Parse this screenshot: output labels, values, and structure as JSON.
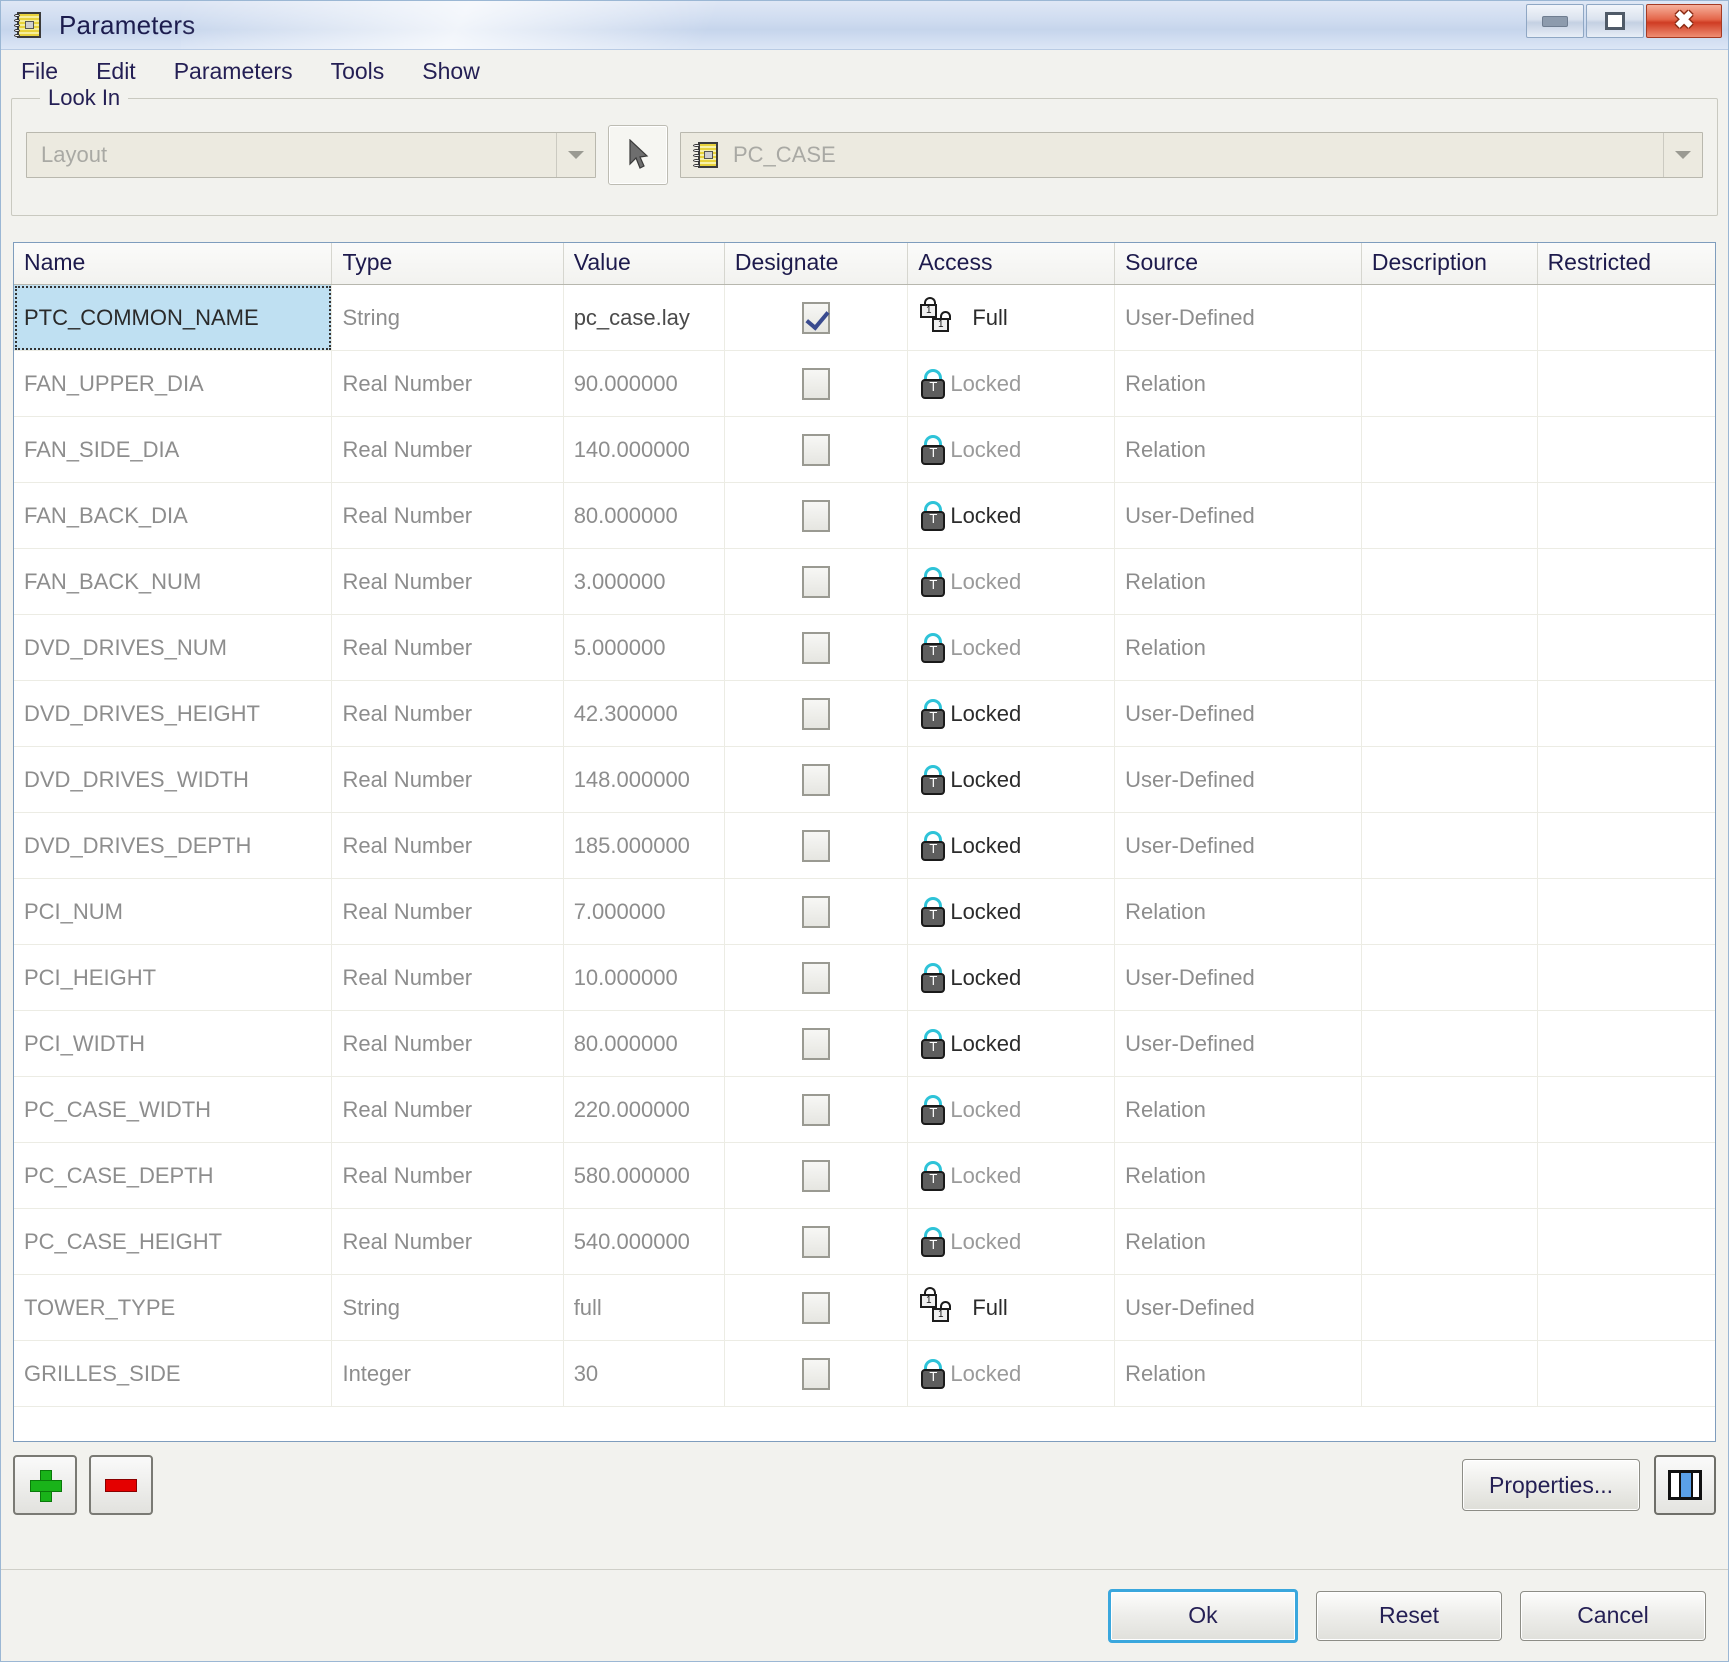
{
  "window": {
    "title": "Parameters",
    "icon": "notepad-icon",
    "controls": {
      "minimize": "minimize-icon",
      "maximize": "maximize-icon",
      "close": "close-icon"
    }
  },
  "menubar": {
    "items": [
      "File",
      "Edit",
      "Parameters",
      "Tools",
      "Show"
    ]
  },
  "look_in": {
    "legend": "Look In",
    "scope_select": {
      "value": "Layout",
      "placeholder": "Layout"
    },
    "pick_button": "select-arrow-icon",
    "object_select": {
      "value": "PC_CASE",
      "icon": "notepad-icon"
    }
  },
  "table": {
    "columns": [
      "Name",
      "Type",
      "Value",
      "Designate",
      "Access",
      "Source",
      "Description",
      "Restricted"
    ],
    "rows": [
      {
        "name": "PTC_COMMON_NAME",
        "type": "String",
        "value": "pc_case.lay",
        "designate": true,
        "access": "Full",
        "access_icon": "unlocked-pair-icon",
        "source": "User-Defined",
        "description": "",
        "restricted": "",
        "selected": true,
        "accent": true
      },
      {
        "name": "FAN_UPPER_DIA",
        "type": "Real Number",
        "value": "90.000000",
        "designate": false,
        "access": "Locked",
        "access_icon": "locked-icon",
        "source": "Relation",
        "description": "",
        "restricted": "",
        "selected": false,
        "accent": false
      },
      {
        "name": "FAN_SIDE_DIA",
        "type": "Real Number",
        "value": "140.000000",
        "designate": false,
        "access": "Locked",
        "access_icon": "locked-icon",
        "source": "Relation",
        "description": "",
        "restricted": "",
        "selected": false,
        "accent": false
      },
      {
        "name": "FAN_BACK_DIA",
        "type": "Real Number",
        "value": "80.000000",
        "designate": false,
        "access": "Locked",
        "access_icon": "locked-icon",
        "source": "User-Defined",
        "description": "",
        "restricted": "",
        "selected": false,
        "accent": true
      },
      {
        "name": "FAN_BACK_NUM",
        "type": "Real Number",
        "value": "3.000000",
        "designate": false,
        "access": "Locked",
        "access_icon": "locked-icon",
        "source": "Relation",
        "description": "",
        "restricted": "",
        "selected": false,
        "accent": false
      },
      {
        "name": "DVD_DRIVES_NUM",
        "type": "Real Number",
        "value": "5.000000",
        "designate": false,
        "access": "Locked",
        "access_icon": "locked-icon",
        "source": "Relation",
        "description": "",
        "restricted": "",
        "selected": false,
        "accent": false
      },
      {
        "name": "DVD_DRIVES_HEIGHT",
        "type": "Real Number",
        "value": "42.300000",
        "designate": false,
        "access": "Locked",
        "access_icon": "locked-icon",
        "source": "User-Defined",
        "description": "",
        "restricted": "",
        "selected": false,
        "accent": true
      },
      {
        "name": "DVD_DRIVES_WIDTH",
        "type": "Real Number",
        "value": "148.000000",
        "designate": false,
        "access": "Locked",
        "access_icon": "locked-icon",
        "source": "User-Defined",
        "description": "",
        "restricted": "",
        "selected": false,
        "accent": true
      },
      {
        "name": "DVD_DRIVES_DEPTH",
        "type": "Real Number",
        "value": "185.000000",
        "designate": false,
        "access": "Locked",
        "access_icon": "locked-icon",
        "source": "User-Defined",
        "description": "",
        "restricted": "",
        "selected": false,
        "accent": true
      },
      {
        "name": "PCI_NUM",
        "type": "Real Number",
        "value": "7.000000",
        "designate": false,
        "access": "Locked",
        "access_icon": "locked-icon",
        "source": "Relation",
        "description": "",
        "restricted": "",
        "selected": false,
        "accent": true
      },
      {
        "name": "PCI_HEIGHT",
        "type": "Real Number",
        "value": "10.000000",
        "designate": false,
        "access": "Locked",
        "access_icon": "locked-icon",
        "source": "User-Defined",
        "description": "",
        "restricted": "",
        "selected": false,
        "accent": true
      },
      {
        "name": "PCI_WIDTH",
        "type": "Real Number",
        "value": "80.000000",
        "designate": false,
        "access": "Locked",
        "access_icon": "locked-icon",
        "source": "User-Defined",
        "description": "",
        "restricted": "",
        "selected": false,
        "accent": true
      },
      {
        "name": "PC_CASE_WIDTH",
        "type": "Real Number",
        "value": "220.000000",
        "designate": false,
        "access": "Locked",
        "access_icon": "locked-icon",
        "source": "Relation",
        "description": "",
        "restricted": "",
        "selected": false,
        "accent": false
      },
      {
        "name": "PC_CASE_DEPTH",
        "type": "Real Number",
        "value": "580.000000",
        "designate": false,
        "access": "Locked",
        "access_icon": "locked-icon",
        "source": "Relation",
        "description": "",
        "restricted": "",
        "selected": false,
        "accent": false
      },
      {
        "name": "PC_CASE_HEIGHT",
        "type": "Real Number",
        "value": "540.000000",
        "designate": false,
        "access": "Locked",
        "access_icon": "locked-icon",
        "source": "Relation",
        "description": "",
        "restricted": "",
        "selected": false,
        "accent": false
      },
      {
        "name": "TOWER_TYPE",
        "type": "String",
        "value": "full",
        "designate": false,
        "access": "Full",
        "access_icon": "unlocked-pair-icon",
        "source": "User-Defined",
        "description": "",
        "restricted": "",
        "selected": false,
        "accent": true
      },
      {
        "name": "GRILLES_SIDE",
        "type": "Integer",
        "value": "30",
        "designate": false,
        "access": "Locked",
        "access_icon": "locked-icon",
        "source": "Relation",
        "description": "",
        "restricted": "",
        "selected": false,
        "accent": false
      }
    ]
  },
  "toolbar": {
    "add_label": "add-parameter",
    "remove_label": "remove-parameter",
    "properties_label": "Properties...",
    "columns_label": "customize-columns"
  },
  "footer": {
    "ok_label": "Ok",
    "reset_label": "Reset",
    "cancel_label": "Cancel"
  },
  "colors": {
    "selection": "#bfe0f2",
    "default_button_border": "#3aa7dd",
    "lock_teal": "#2ec3d8",
    "add_green": "#19b319",
    "remove_red": "#e40000"
  }
}
